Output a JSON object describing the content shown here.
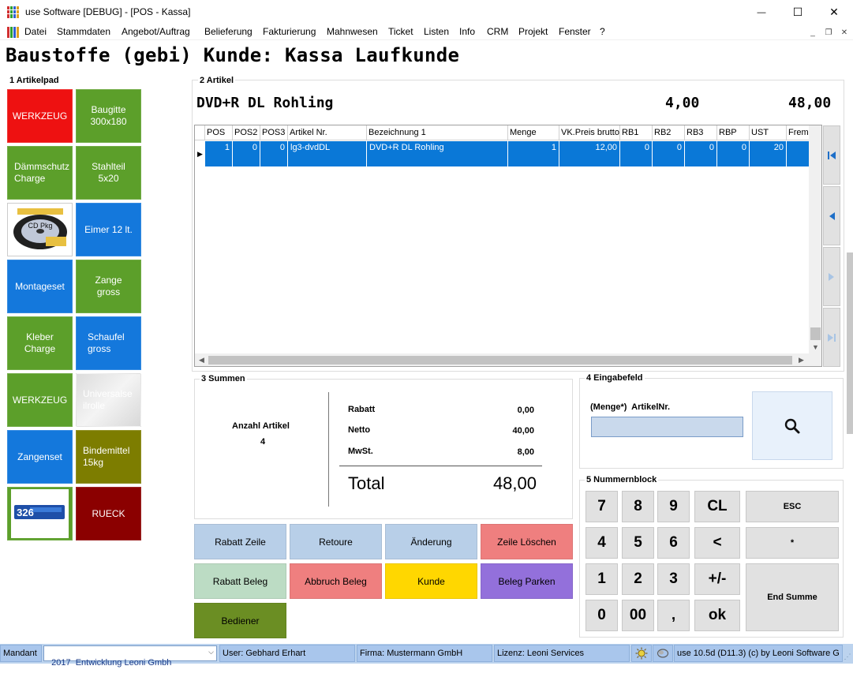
{
  "window": {
    "title": "use Software [DEBUG] - [POS - Kassa]",
    "minimize_glyph": "—",
    "maximize_glyph": "☐",
    "close_glyph": "✕"
  },
  "menu": [
    {
      "label": "Datei"
    },
    {
      "label": "Stammdaten"
    },
    {
      "label": "Angebot/Auftrag"
    },
    {
      "label": "Belieferung"
    },
    {
      "label": "Fakturierung"
    },
    {
      "label": "Mahnwesen"
    },
    {
      "label": "Ticket"
    },
    {
      "label": "Listen"
    },
    {
      "label": "Info"
    },
    {
      "label": "CRM"
    },
    {
      "label": "Projekt"
    },
    {
      "label": "Fenster"
    },
    {
      "label": "?"
    }
  ],
  "header": {
    "title": "Baustoffe (gebi) Kunde: Kassa Laufkunde"
  },
  "artikelpad": {
    "label": "1 Artikelpad",
    "buttons": [
      {
        "label": "WERKZEUG",
        "color": "#ee1111"
      },
      {
        "label": "Baugitte 300x180",
        "color": "#5c9f2a"
      },
      {
        "label": "Dämmschutz Charge",
        "color": "#5c9f2a"
      },
      {
        "label": "Stahlteil 5x20",
        "color": "#5c9f2a"
      },
      {
        "label": "CD Pkg",
        "color": "#ffffff",
        "icon": "cd-spindle-image"
      },
      {
        "label": "Eimer 12 lt.",
        "color": "#1478dc"
      },
      {
        "label": "Montageset",
        "color": "#1478dc"
      },
      {
        "label": "Zange gross",
        "color": "#5c9f2a"
      },
      {
        "label": "Kleber Charge",
        "color": "#5c9f2a"
      },
      {
        "label": "Schaufel gross",
        "color": "#1478dc"
      },
      {
        "label": "WERKZEUG",
        "color": "#5c9f2a"
      },
      {
        "label": "Universalseilrolle",
        "color": "#e8e8e8"
      },
      {
        "label": "Zangenset",
        "color": "#1478dc"
      },
      {
        "label": "Bindemittel 15kg",
        "color": "#7d7d00"
      },
      {
        "label": "326",
        "color": "#5c9f2a",
        "icon": "toner-cartridge-image"
      },
      {
        "label": "RUECK",
        "color": "#8b0000"
      }
    ]
  },
  "artikel": {
    "label": "2 Artikel",
    "current_name": "DVD+R DL Rohling",
    "current_qty": "4,00",
    "current_total": "48,00",
    "columns": [
      "POS",
      "POS2",
      "POS3",
      "Artikel Nr.",
      "Bezeichnung 1",
      "Menge",
      "VK.Preis brutto",
      "RB1",
      "RB2",
      "RB3",
      "RBP",
      "UST",
      "Frem"
    ],
    "rows": [
      [
        "1",
        "0",
        "0",
        "lg3-dvdDL",
        "DVD+R DL Rohling",
        "1",
        "12,00",
        "0",
        "0",
        "0",
        "0",
        "20",
        ""
      ]
    ]
  },
  "summen": {
    "label": "3 Summen",
    "anzahl_label": "Anzahl Artikel",
    "anzahl_value": "4",
    "rabatt_label": "Rabatt",
    "rabatt_value": "0,00",
    "netto_label": "Netto",
    "netto_value": "40,00",
    "mwst_label": "MwSt.",
    "mwst_value": "8,00",
    "total_label": "Total",
    "total_value": "48,00"
  },
  "eingabe": {
    "label": "4 Eingabefeld",
    "field_label": "(Menge*)  ArtikelNr.",
    "value": ""
  },
  "nummernblock": {
    "label": "5 Nummernblock",
    "keys": [
      "7",
      "8",
      "9",
      "CL",
      "4",
      "5",
      "6",
      "<",
      "1",
      "2",
      "3",
      "+/-",
      "0",
      "00",
      ",",
      "ok"
    ],
    "esc": "ESC",
    "star": "*",
    "end_summe": "End Summe"
  },
  "actions": [
    {
      "label": "Rabatt Zeile",
      "color": "#b8cfe8"
    },
    {
      "label": "Retoure",
      "color": "#b8cfe8"
    },
    {
      "label": "Änderung",
      "color": "#b8cfe8"
    },
    {
      "label": "Zeile Löschen",
      "color": "#ef7f7f"
    },
    {
      "label": "Rabatt Beleg",
      "color": "#bcdcc4"
    },
    {
      "label": "Abbruch Beleg",
      "color": "#ef7f7f"
    },
    {
      "label": "Kunde",
      "color": "#ffd700"
    },
    {
      "label": "Beleg Parken",
      "color": "#9370db"
    },
    {
      "label": "Bediener",
      "color": "#6b8e23"
    }
  ],
  "status": {
    "mandant_label": "Mandant",
    "mandant_value": "2017  Entwicklung Leoni Gmbh",
    "user": "User: Gebhard Erhart",
    "firma": "Firma: Mustermann GmbH",
    "lizenz": "Lizenz: Leoni Services",
    "version": "use 10.5d (D11.3) (c) by Leoni Software G"
  },
  "colors": {
    "selection": "#0a78d7",
    "status_bar": "#bcd3ee"
  }
}
